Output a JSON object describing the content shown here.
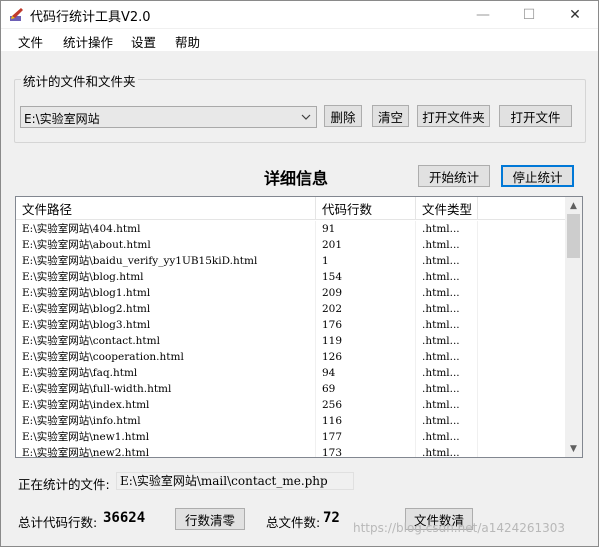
{
  "window": {
    "title": "代码行统计工具V2.0",
    "controls": {
      "minimize": "—",
      "maximize": "☐",
      "close": "✕"
    }
  },
  "menu": [
    "文件",
    "统计操作",
    "设置",
    "帮助"
  ],
  "files_group": {
    "title": "统计的文件和文件夹",
    "selected_path": "E:\\实验室网站",
    "buttons": {
      "delete": "删除",
      "clear": "清空",
      "open_folder": "打开文件夹",
      "open_file": "打开文件"
    }
  },
  "details": {
    "title": "详细信息",
    "start_button": "开始统计",
    "stop_button": "停止统计"
  },
  "table": {
    "columns": [
      "文件路径",
      "代码行数",
      "文件类型"
    ],
    "rows": [
      [
        "E:\\实验室网站\\404.html",
        "91",
        ".html..."
      ],
      [
        "E:\\实验室网站\\about.html",
        "201",
        ".html..."
      ],
      [
        "E:\\实验室网站\\baidu_verify_yy1UB15kiD.html",
        "1",
        ".html..."
      ],
      [
        "E:\\实验室网站\\blog.html",
        "154",
        ".html..."
      ],
      [
        "E:\\实验室网站\\blog1.html",
        "209",
        ".html..."
      ],
      [
        "E:\\实验室网站\\blog2.html",
        "202",
        ".html..."
      ],
      [
        "E:\\实验室网站\\blog3.html",
        "176",
        ".html..."
      ],
      [
        "E:\\实验室网站\\contact.html",
        "119",
        ".html..."
      ],
      [
        "E:\\实验室网站\\cooperation.html",
        "126",
        ".html..."
      ],
      [
        "E:\\实验室网站\\faq.html",
        "94",
        ".html..."
      ],
      [
        "E:\\实验室网站\\full-width.html",
        "69",
        ".html..."
      ],
      [
        "E:\\实验室网站\\index.html",
        "256",
        ".html..."
      ],
      [
        "E:\\实验室网站\\info.html",
        "116",
        ".html..."
      ],
      [
        "E:\\实验室网站\\new1.html",
        "177",
        ".html..."
      ],
      [
        "E:\\实验室网站\\new2.html",
        "173",
        ".html..."
      ]
    ]
  },
  "status": {
    "current_label": "正在统计的文件:",
    "current_file": "E:\\实验室网站\\mail\\contact_me.php",
    "total_lines_label": "总计代码行数:",
    "total_lines": "36624",
    "reset_lines_button": "行数清零",
    "total_files_label": "总文件数:",
    "total_files": "72",
    "reset_files_button": "文件数清"
  },
  "watermark": "https://blog.csdn.net/a1424261303"
}
